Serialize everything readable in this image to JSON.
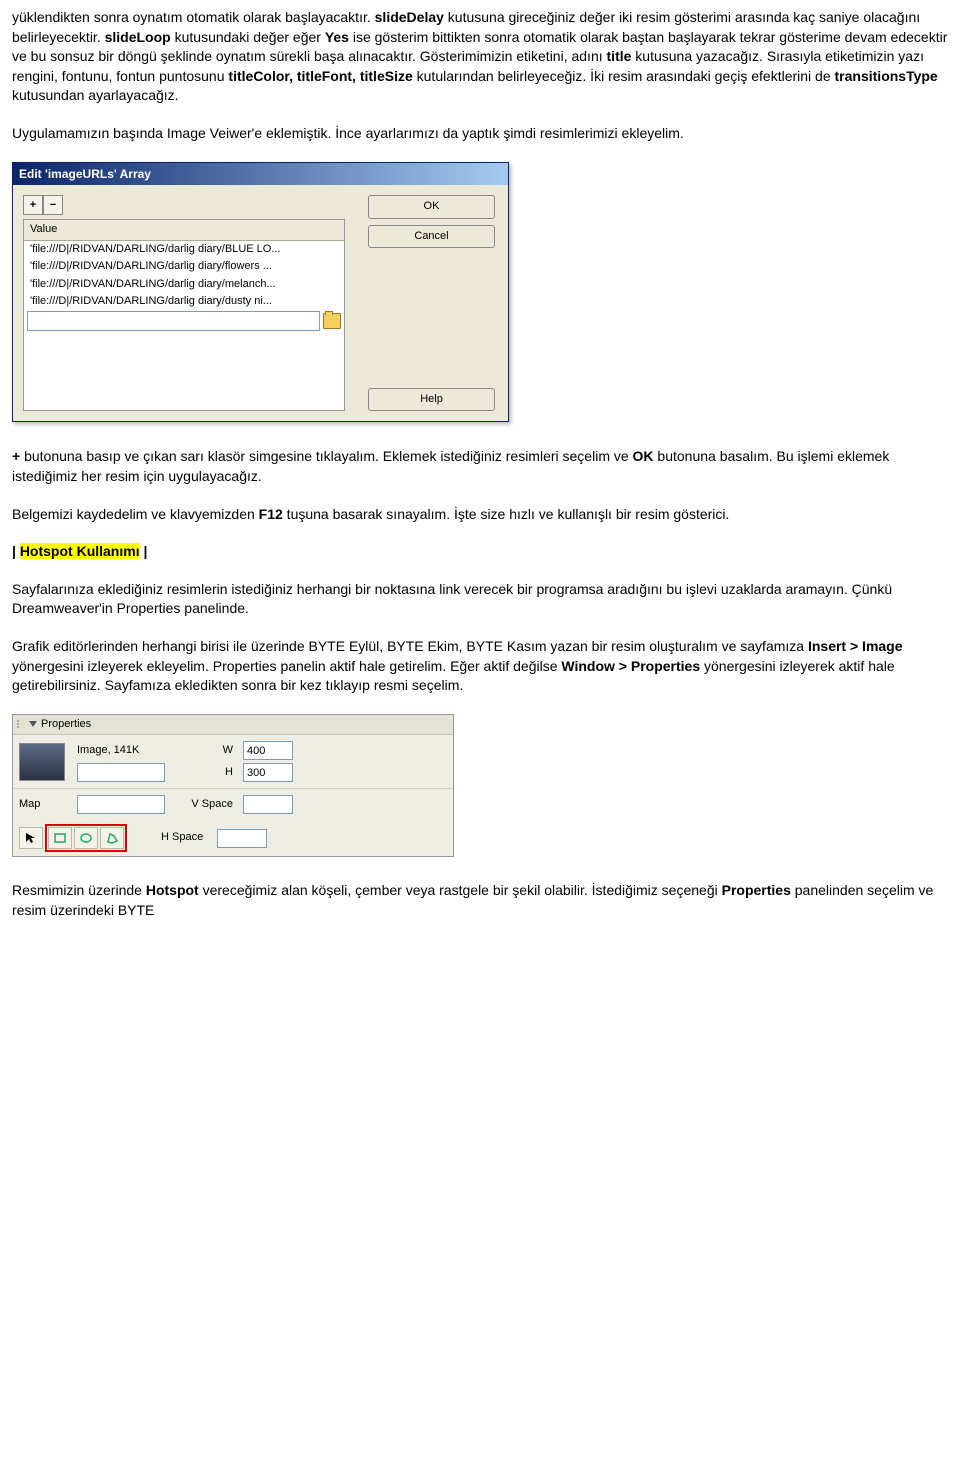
{
  "para1_pre": "yüklendikten sonra oynatım otomatik olarak başlayacaktır. ",
  "b_slideDelay": "slideDelay",
  "para1_post": " kutusuna gireceğiniz değer iki resim gösterimi arasında kaç saniye olacağını belirleyecektir. ",
  "b_slideLoop": "slideLoop",
  "para1_b2": " kutusundaki değer eğer ",
  "b_yes": "Yes",
  "para1_c": " ise gösterim bittikten sonra otomatik olarak baştan başlayarak tekrar gösterime devam edecektir ve bu sonsuz bir döngü şeklinde oynatım sürekli başa alınacaktır. Gösterimimizin etiketini, adını ",
  "b_title": "title",
  "para1_d": " kutusuna yazacağız. Sırasıyla etiketimizin yazı rengini, fontunu, fontun puntosunu ",
  "b_titleColor": "titleColor, titleFont, titleSize",
  "para1_e": " kutularından belirleyeceğiz. İki resim arasındaki geçiş efektlerini de ",
  "b_transitionsType": "transitionsType",
  "para1_f": " kutusundan ayarlayacağız.",
  "para2": "Uygulamamızın başında Image Veiwer'e eklemiştik. İnce ayarlarımızı da yaptık şimdi resimlerimizi ekleyelim.",
  "dialog": {
    "title": "Edit 'imageURLs' Array",
    "valueHeader": "Value",
    "items": [
      "'file:///D|/RIDVAN/DARLING/darlig diary/BLUE LO...",
      "'file:///D|/RIDVAN/DARLING/darlig diary/flowers ...",
      "'file:///D|/RIDVAN/DARLING/darlig diary/melanch...",
      "'file:///D|/RIDVAN/DARLING/darlig diary/dusty ni..."
    ],
    "ok": "OK",
    "cancel": "Cancel",
    "help": "Help"
  },
  "para3a": "+",
  "para3b": " butonuna basıp ve çıkan sarı klasör simgesine tıklayalım. Eklemek istediğiniz resimleri seçelim ve ",
  "b_ok": "OK",
  "para3c": " butonuna basalım. Bu işlemi eklemek istediğimiz her resim için uygulayacağız.",
  "para4a": "Belgemizi kaydedelim ve klavyemizden ",
  "b_f12": "F12",
  "para4b": " tuşuna basarak sınayalım. İşte size hızlı ve kullanışlı bir resim gösterici.",
  "hotspot_heading": "Hotspot Kullanımı",
  "para5": "Sayfalarınıza eklediğiniz resimlerin istediğiniz herhangi bir noktasına link verecek bir programsa aradığını bu işlevi uzaklarda aramayın. Çünkü Dreamweaver'in Properties panelinde.",
  "para6a": "Grafik editörlerinden herhangi birisi ile üzerinde BYTE Eylül, BYTE Ekim, BYTE Kasım yazan bir resim oluşturalım ve sayfamıza ",
  "b_insertImage": "Insert > Image",
  "para6b": " yönergesini izleyerek ekleyelim. Properties panelin aktif hale getirelim. Eğer aktif değilse ",
  "b_winProp": "Window > Properties",
  "para6c": " yönergesini izleyerek aktif hale getirebilirsiniz. Sayfamıza ekledikten sonra bir kez tıklayıp resmi seçelim.",
  "prop": {
    "header": "Properties",
    "imageLabel": "Image, 141K",
    "w": "W",
    "wval": "400",
    "h": "H",
    "hval": "300",
    "map": "Map",
    "vspace": "V Space",
    "hspace": "H Space"
  },
  "para7a": "Resmimizin üzerinde ",
  "b_hotspot": "Hotspot",
  "para7b": " vereceğimiz alan köşeli, çember veya rastgele bir şekil olabilir. İstediğimiz seçeneği ",
  "b_properties": "Properties",
  "para7c": " panelinden seçelim ve resim üzerindeki BYTE"
}
